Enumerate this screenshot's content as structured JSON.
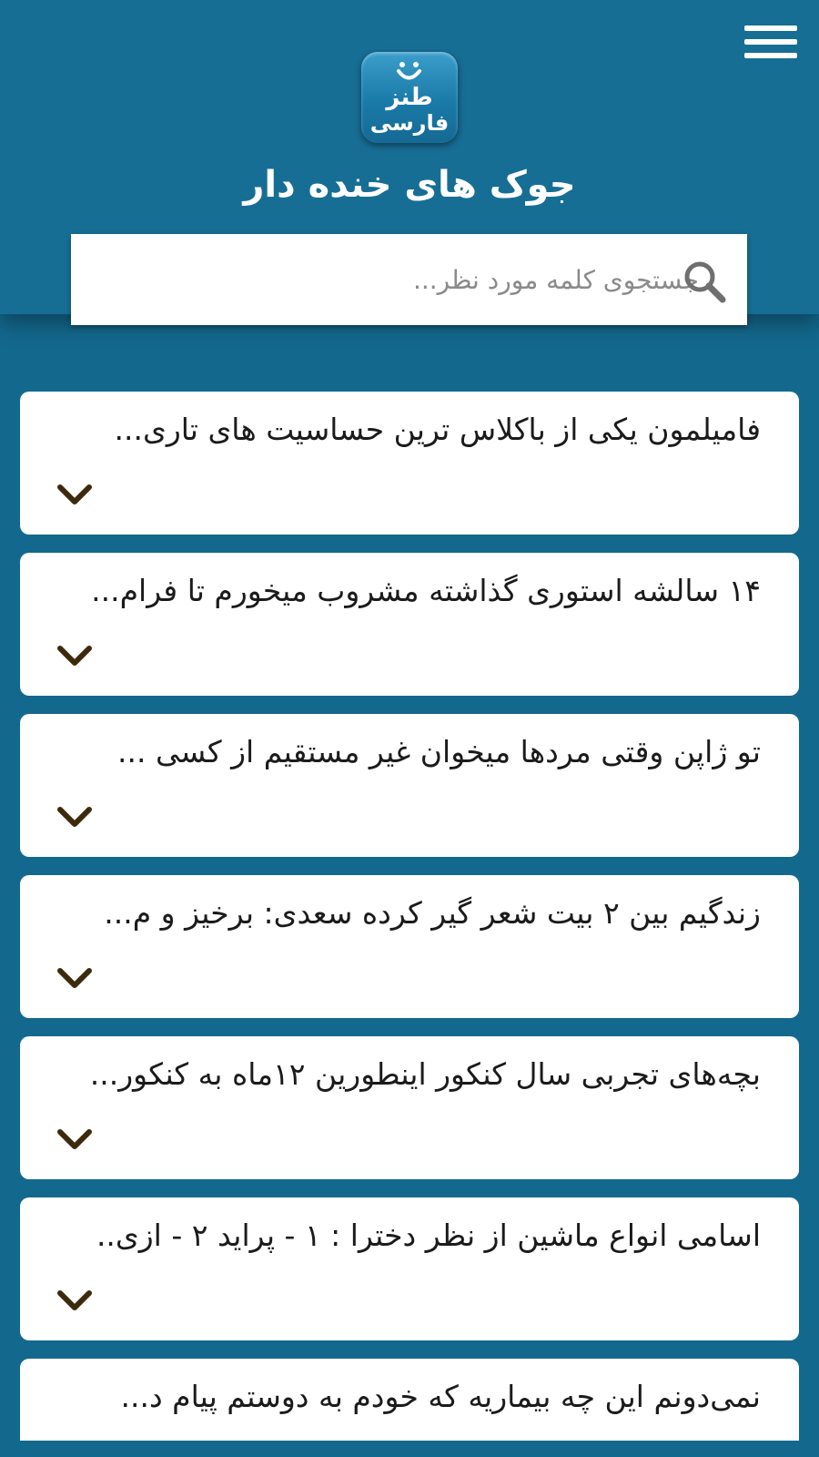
{
  "header": {
    "title": "جوک های خنده دار",
    "logo_text_top": "طنز",
    "logo_text_bottom": "فارسی"
  },
  "search": {
    "placeholder": "جستجوی کلمه مورد نظر..."
  },
  "jokes": [
    {
      "preview": "فامیلمون یکی از باکلاس ترین حساسیت های تاری..."
    },
    {
      "preview": "۱۴ سالشه استوری گذاشته  مشروب میخورم تا فرام..."
    },
    {
      "preview": "تو ژاپن وقتی مردها میخوان غیر مستقیم از کسی ..."
    },
    {
      "preview": "زندگیم بین ۲ بیت شعر گیر کرده سعدی: برخیز و م..."
    },
    {
      "preview": "بچه‌های تجربی سال کنکور اینطورین ۱۲ماه به کنکور..."
    },
    {
      "preview": "اسامی انواع ماشین از نظر دخترا : ۱ - پراید  ۲ - ازی.."
    },
    {
      "preview": "نمی‌دونم این چه بیماریه که خودم به دوستم پیام د..."
    }
  ],
  "colors": {
    "background": "#13688d",
    "header": "#176e95",
    "card": "#ffffff",
    "chevron": "#3d2a0c"
  },
  "icons": {
    "menu": "hamburger-menu-icon",
    "search": "search-icon",
    "expand": "chevron-down-icon"
  }
}
